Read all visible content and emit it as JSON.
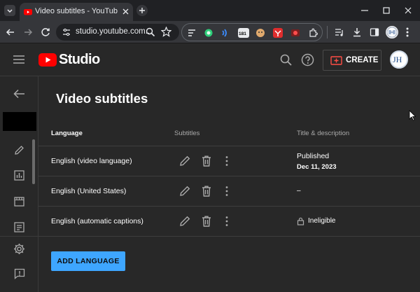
{
  "browser": {
    "tab_title": "Video subtitles - YouTube Studio",
    "url": "studio.youtube.com...",
    "extensions": {
      "ext_badge_181": "181"
    }
  },
  "header": {
    "logo_text": "Studio",
    "create_label": "CREATE",
    "avatar_initials": "JH"
  },
  "page": {
    "title": "Video subtitles"
  },
  "table": {
    "columns": {
      "language": "Language",
      "subtitles": "Subtitles",
      "title_desc": "Title & description"
    },
    "rows": [
      {
        "language": "English (video language)",
        "status": "Published",
        "date": "Dec 11, 2023"
      },
      {
        "language": "English (United States)",
        "status": "–"
      },
      {
        "language": "English (automatic captions)",
        "status": "Ineligible"
      }
    ]
  },
  "actions": {
    "add_language": "ADD LANGUAGE"
  },
  "colors": {
    "accent": "#3ea6ff",
    "brand_red": "#ff0000",
    "background": "#282828"
  }
}
